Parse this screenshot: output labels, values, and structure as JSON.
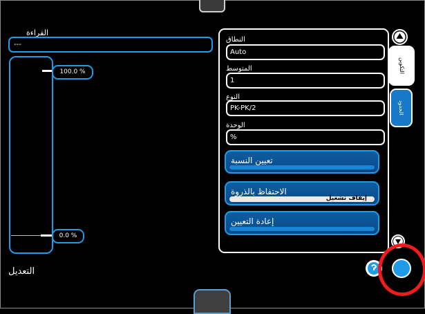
{
  "reading": {
    "label": "القراءة",
    "value": "---"
  },
  "gauge": {
    "top_label": "100.0 %",
    "bottom_label": "0.0 %"
  },
  "adjust_label": "التعديل",
  "settings": {
    "range": {
      "label": "النطاق",
      "value": "Auto"
    },
    "average": {
      "label": "المتوسط",
      "value": "1"
    },
    "type": {
      "label": "النوع",
      "value": "PK-PK/2"
    },
    "unit": {
      "label": "الوحدة",
      "value": "%"
    }
  },
  "buttons": {
    "set_ratio": "تعيين النسبة",
    "peak_hold": "الاحتفاظ بالذروة",
    "peak_hold_state": "إيقاف تشغيل",
    "reset": "إعادة التعيين"
  },
  "tabs": {
    "config": "التكوين",
    "limits": "الحدود"
  },
  "colors": {
    "accent": "#1f9be8",
    "button_fill": "#0d5da3",
    "annotation": "#ee1c1c"
  }
}
